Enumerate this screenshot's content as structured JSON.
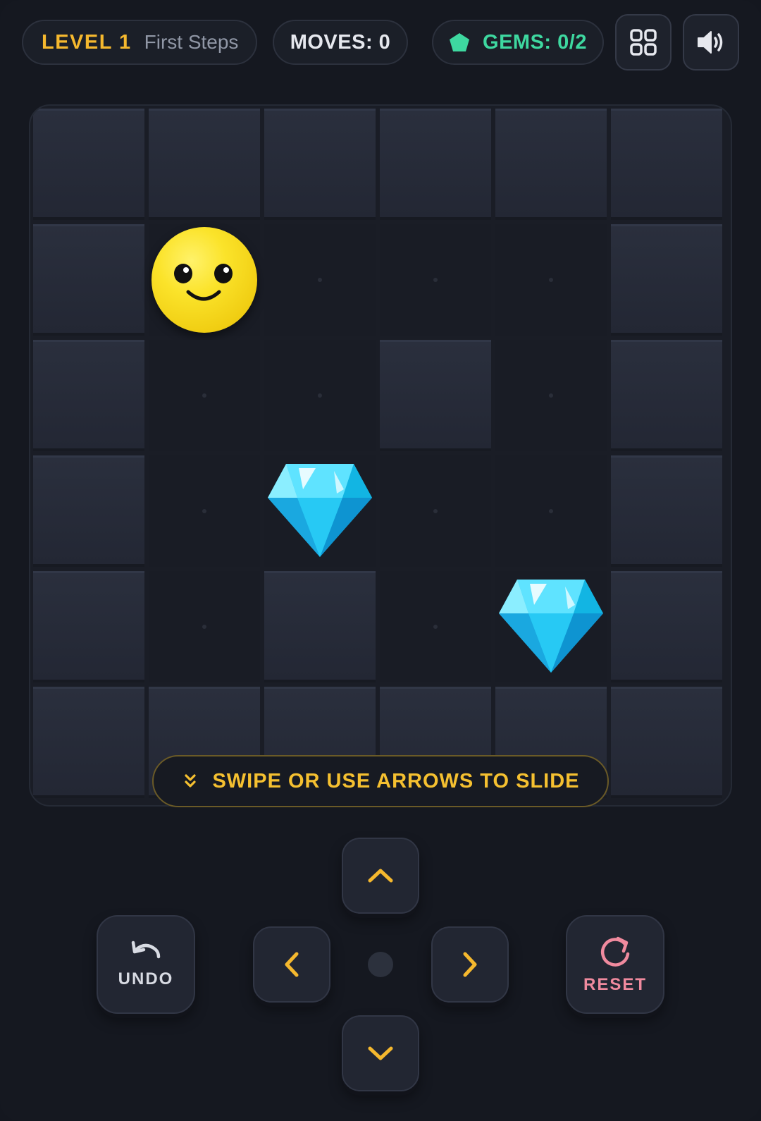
{
  "header": {
    "level_label": "LEVEL 1",
    "level_name": "First Steps",
    "moves_label": "MOVES: 0",
    "gems_label": "GEMS: 0/2",
    "gems_icon": "gem-icon",
    "grid_icon": "grid-menu-icon",
    "sound_icon": "speaker-volume-icon"
  },
  "board": {
    "rows": 6,
    "cols": 6,
    "layout": [
      "######",
      "#P...#",
      "#..#.#",
      "#.G..#",
      "#.#.G#",
      "######"
    ],
    "legend": {
      "#": "wall",
      ".": "floor",
      "P": "player",
      "G": "gem"
    }
  },
  "hint": {
    "text": "SWIPE OR USE ARROWS TO SLIDE",
    "icon": "double-chevron-down-icon"
  },
  "controls": {
    "undo_label": "UNDO",
    "reset_label": "RESET",
    "undo_icon": "undo-arrow-icon",
    "reset_icon": "reset-circular-arrow-icon",
    "up_icon": "chevron-up-icon",
    "down_icon": "chevron-down-icon",
    "left_icon": "chevron-left-icon",
    "right_icon": "chevron-right-icon"
  },
  "colors": {
    "accent_gold": "#f5b82e",
    "gem_green": "#3ed8a0",
    "reset_pink": "#f08a9e",
    "player_yellow": "#fbe32a",
    "gem_cyan": "#22d3f5"
  }
}
